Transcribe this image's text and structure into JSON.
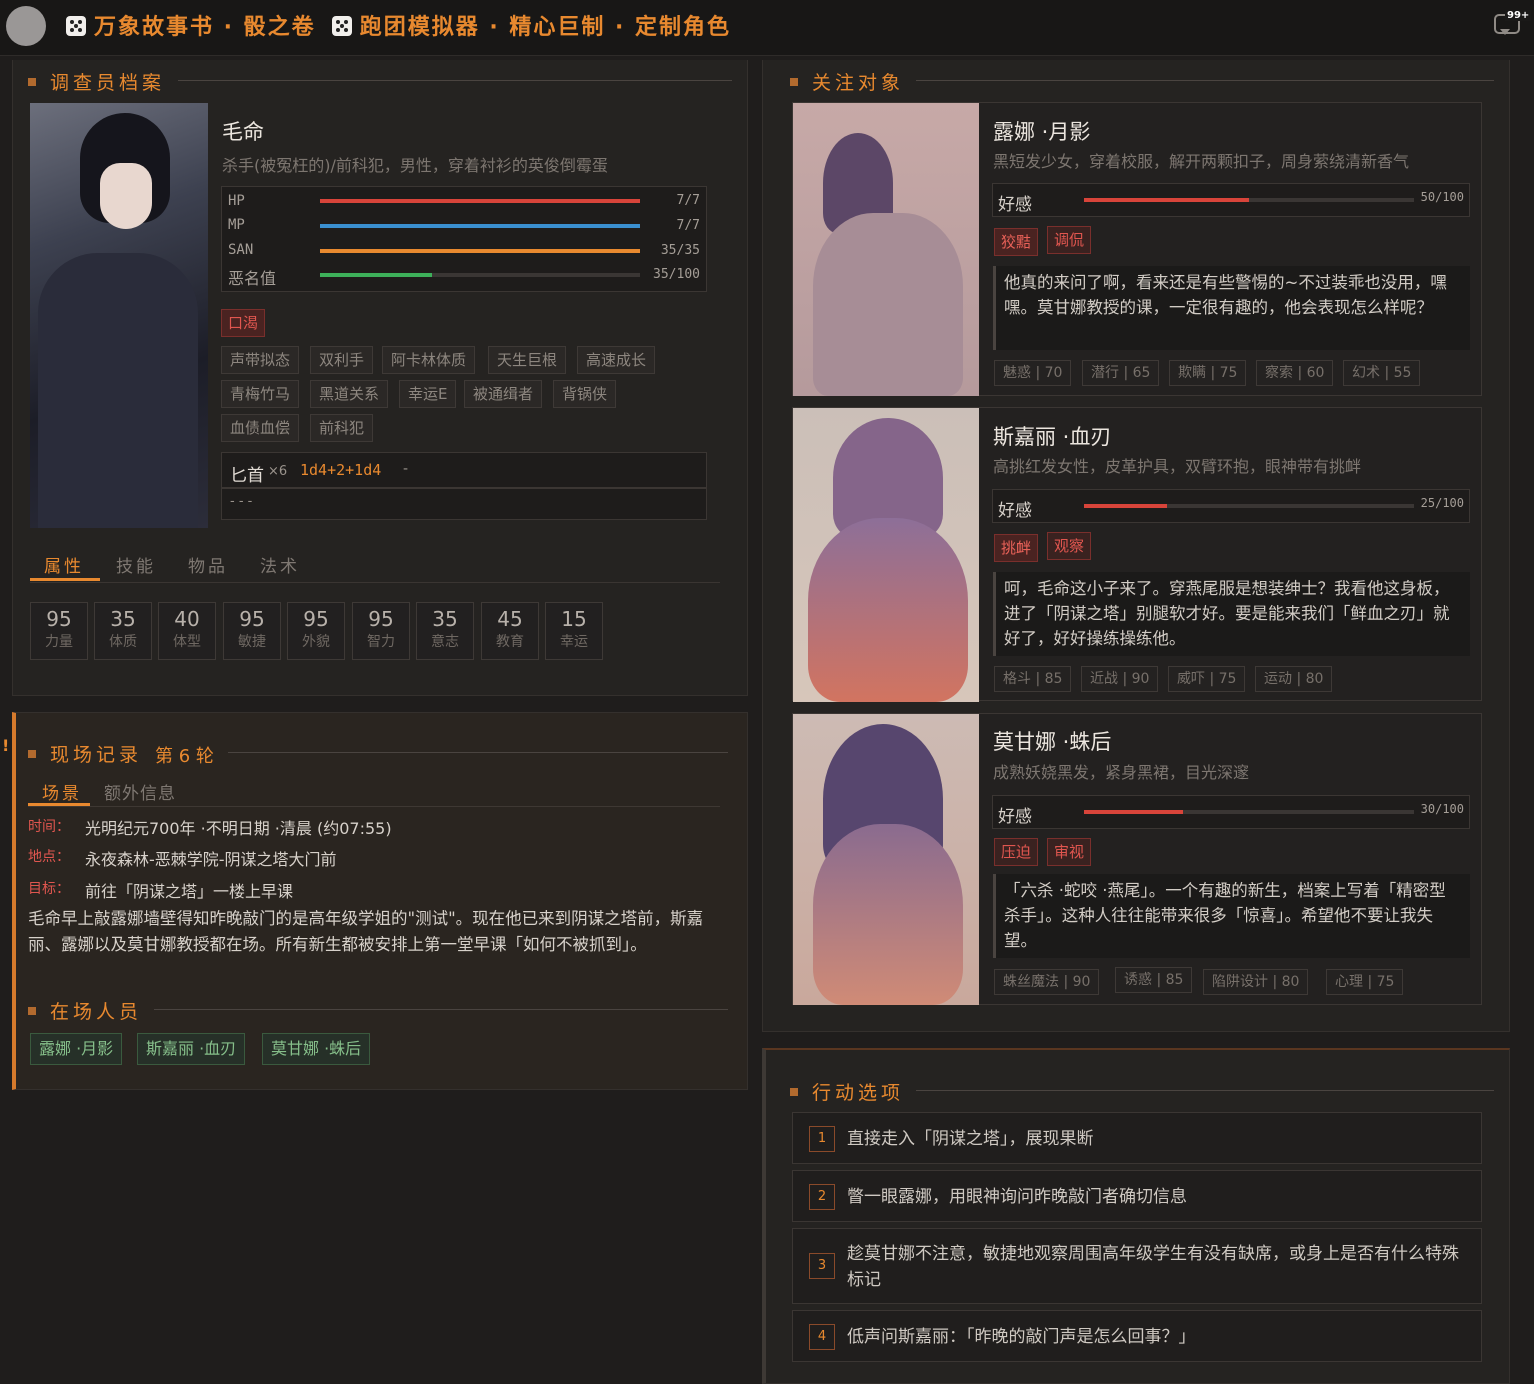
{
  "header": {
    "title_part1": "万象故事书 · 骰之卷",
    "title_part2": "跑团模拟器 · 精心巨制 · 定制角色",
    "badge": "99+"
  },
  "investigator": {
    "section_title": "调查员档案",
    "name": "毛命",
    "desc": "杀手(被冤枉的)/前科犯，男性，穿着衬衫的英俊倒霉蛋",
    "stats": [
      {
        "label": "HP",
        "value": "7/7",
        "ratio": 1.0,
        "color": "#d8443a"
      },
      {
        "label": "MP",
        "value": "7/7",
        "ratio": 1.0,
        "color": "#3a8fd0"
      },
      {
        "label": "SAN",
        "value": "35/35",
        "ratio": 1.0,
        "color": "#e8892f"
      },
      {
        "label": "恶名值",
        "value": "35/100",
        "ratio": 0.35,
        "color": "#3db05a"
      }
    ],
    "status": "口渴",
    "traits": [
      "声带拟态",
      "双利手",
      "阿卡林体质",
      "天生巨根",
      "高速成长",
      "青梅竹马",
      "黑道关系",
      "幸运E",
      "被通缉者",
      "背锅侠",
      "血债血偿",
      "前科犯"
    ],
    "weapon": {
      "name": "匕首",
      "count": "×6",
      "dice": "1d4+2+1d4",
      "suffix": "-",
      "empty": "- - -"
    },
    "tabs": [
      "属性",
      "技能",
      "物品",
      "法术"
    ],
    "attributes": [
      {
        "value": "95",
        "label": "力量"
      },
      {
        "value": "35",
        "label": "体质"
      },
      {
        "value": "40",
        "label": "体型"
      },
      {
        "value": "95",
        "label": "敏捷"
      },
      {
        "value": "95",
        "label": "外貌"
      },
      {
        "value": "95",
        "label": "智力"
      },
      {
        "value": "35",
        "label": "意志"
      },
      {
        "value": "45",
        "label": "教育"
      },
      {
        "value": "15",
        "label": "幸运"
      }
    ]
  },
  "scene": {
    "section_title": "现场记录",
    "round": "第 6 轮",
    "tabs": [
      "场景",
      "额外信息"
    ],
    "time_label": "时间：",
    "time": "光明纪元700年 ·不明日期 ·清晨 (约07:55)",
    "place_label": "地点：",
    "place": "永夜森林-恶棘学院-阴谋之塔大门前",
    "goal_label": "目标：",
    "goal": "前往「阴谋之塔」一楼上早课",
    "narrative": "毛命早上敲露娜墙壁得知昨晚敲门的是高年级学姐的\"测试\"。现在他已来到阴谋之塔前，斯嘉丽、露娜以及莫甘娜教授都在场。所有新生都被安排上第一堂早课「如何不被抓到」。",
    "present_title": "在场人员",
    "present": [
      "露娜 ·月影",
      "斯嘉丽 ·血刃",
      "莫甘娜 ·蛛后"
    ]
  },
  "focus": {
    "section_title": "关注对象",
    "affection_label": "好感",
    "characters": [
      {
        "name": "露娜 ·月影",
        "desc": "黑短发少女，穿着校服，解开两颗扣子，周身萦绕清新香气",
        "affection": "50/100",
        "ratio": 0.5,
        "tags": [
          "狡黠",
          "调侃"
        ],
        "quote": "他真的来问了啊，看来还是有些警惕的~不过装乖也没用，嘿嘿。莫甘娜教授的课，一定很有趣的，他会表现怎么样呢？",
        "skills": [
          "魅惑 | 70",
          "潜行 | 65",
          "欺瞒 | 75",
          "察索 | 60",
          "幻术 | 55"
        ]
      },
      {
        "name": "斯嘉丽 ·血刃",
        "desc": "高挑红发女性，皮革护具，双臂环抱，眼神带有挑衅",
        "affection": "25/100",
        "ratio": 0.25,
        "tags": [
          "挑衅",
          "观察"
        ],
        "quote": "呵，毛命这小子来了。穿燕尾服是想装绅士？我看他这身板，进了「阴谋之塔」别腿软才好。要是能来我们「鲜血之刃」就好了，好好操练操练他。",
        "skills": [
          "格斗 | 85",
          "近战 | 90",
          "威吓 | 75",
          "运动 | 80"
        ]
      },
      {
        "name": "莫甘娜 ·蛛后",
        "desc": "成熟妖娆黑发，紧身黑裙，目光深邃",
        "affection": "30/100",
        "ratio": 0.3,
        "tags": [
          "压迫",
          "审视"
        ],
        "quote": "「六杀 ·蛇咬 ·燕尾」。一个有趣的新生，档案上写着「精密型杀手」。这种人往往能带来很多「惊喜」。希望他不要让我失望。",
        "skills": [
          "蛛丝魔法 | 90",
          "诱惑 | 85",
          "陷阱设计 | 80",
          "心理 | 75"
        ]
      }
    ]
  },
  "actions": {
    "section_title": "行动选项",
    "items": [
      {
        "num": "1",
        "text": "直接走入「阴谋之塔」，展现果断"
      },
      {
        "num": "2",
        "text": "瞥一眼露娜，用眼神询问昨晚敲门者确切信息"
      },
      {
        "num": "3",
        "text": "趁莫甘娜不注意，敏捷地观察周围高年级学生有没有缺席，或身上是否有什么特殊标记"
      },
      {
        "num": "4",
        "text": "低声问斯嘉丽：「昨晚的敲门声是怎么回事？」"
      }
    ]
  }
}
